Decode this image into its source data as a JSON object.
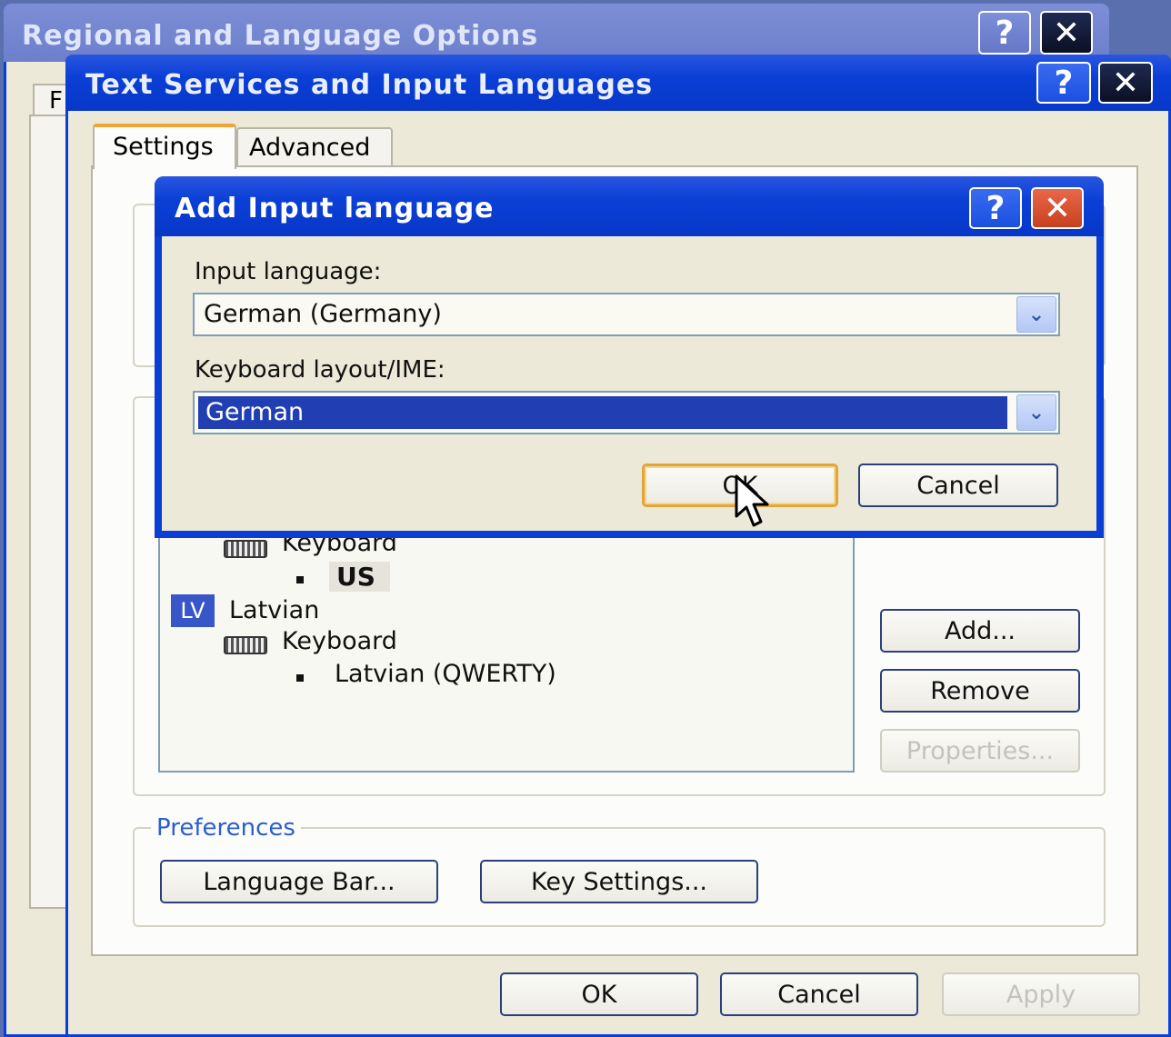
{
  "regional_window": {
    "title": "Regional and Language Options",
    "help_label": "?",
    "close_label": "✕"
  },
  "text_services_window": {
    "title": "Text Services and Input Languages",
    "help_label": "?",
    "close_label": "✕",
    "tabs": [
      {
        "label": "Settings",
        "active": true
      },
      {
        "label": "Advanced",
        "active": false
      }
    ],
    "installed_services": [
      {
        "type": "service",
        "label": "Keyboard"
      },
      {
        "type": "layout",
        "label": "US"
      },
      {
        "type": "language",
        "code": "LV",
        "label": "Latvian"
      },
      {
        "type": "service",
        "label": "Keyboard"
      },
      {
        "type": "layout",
        "label": "Latvian (QWERTY)"
      }
    ],
    "buttons": {
      "add": "Add...",
      "remove": "Remove",
      "properties": "Properties..."
    },
    "preferences": {
      "title": "Preferences",
      "language_bar": "Language Bar...",
      "key_settings": "Key Settings..."
    },
    "footer": {
      "ok": "OK",
      "cancel": "Cancel",
      "apply": "Apply"
    }
  },
  "add_input_dialog": {
    "title": "Add Input language",
    "help_label": "?",
    "close_label": "✕",
    "input_language_label": "Input language:",
    "input_language_value": "German (Germany)",
    "keyboard_layout_label": "Keyboard layout/IME:",
    "keyboard_layout_value": "German",
    "ok": "OK",
    "cancel": "Cancel"
  },
  "colors": {
    "title_blue": "#0a3fd6",
    "dialog_face": "#ece9d8",
    "selection": "#213fb2",
    "focus_ring": "#e0a63b"
  }
}
